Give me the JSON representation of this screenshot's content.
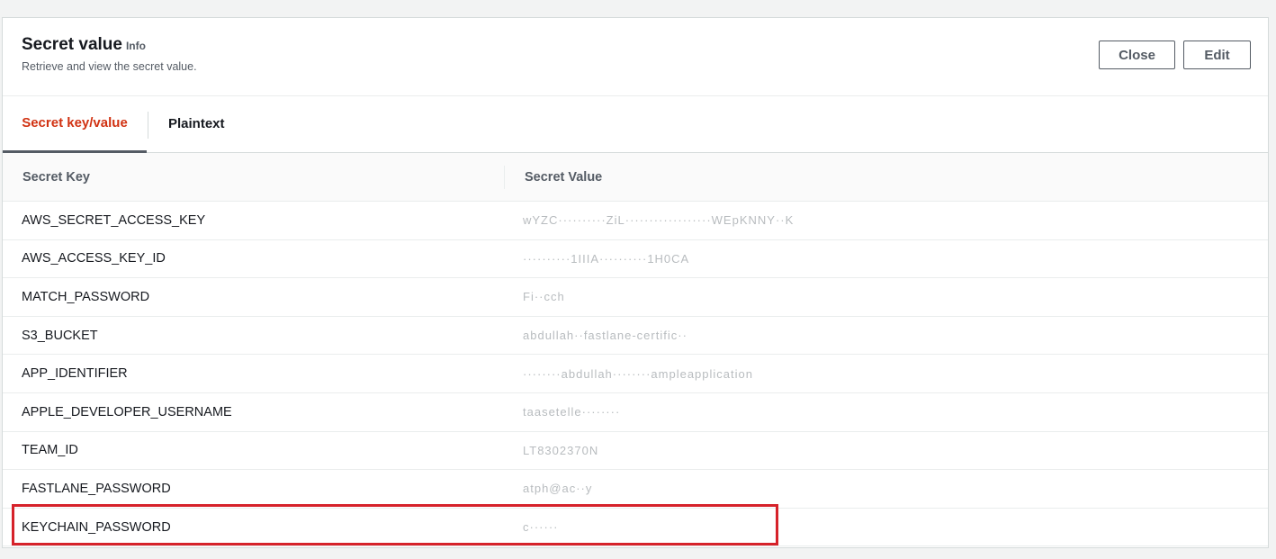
{
  "header": {
    "title": "Secret value",
    "info_link": "Info",
    "subtitle": "Retrieve and view the secret value.",
    "close_label": "Close",
    "edit_label": "Edit"
  },
  "tabs": [
    {
      "label": "Secret key/value",
      "active": true
    },
    {
      "label": "Plaintext",
      "active": false
    }
  ],
  "table": {
    "columns": [
      "Secret Key",
      "Secret Value"
    ],
    "rows": [
      {
        "key": "AWS_SECRET_ACCESS_KEY",
        "value": "wYZC··········ZiL··················WEpKNNY··K"
      },
      {
        "key": "AWS_ACCESS_KEY_ID",
        "value": "··········1IIIA··········1H0CA"
      },
      {
        "key": "MATCH_PASSWORD",
        "value": "Fi··cch"
      },
      {
        "key": "S3_BUCKET",
        "value": "abdullah··fastlane-certific··"
      },
      {
        "key": "APP_IDENTIFIER",
        "value": "········abdullah········ampleapplication"
      },
      {
        "key": "APPLE_DEVELOPER_USERNAME",
        "value": "taasetelle········"
      },
      {
        "key": "TEAM_ID",
        "value": "LT8302370N"
      },
      {
        "key": "FASTLANE_PASSWORD",
        "value": "atph@ac··y"
      },
      {
        "key": "KEYCHAIN_PASSWORD",
        "value": "c······"
      }
    ]
  },
  "highlight_color": "#d6222a",
  "accent_color": "#d13212"
}
